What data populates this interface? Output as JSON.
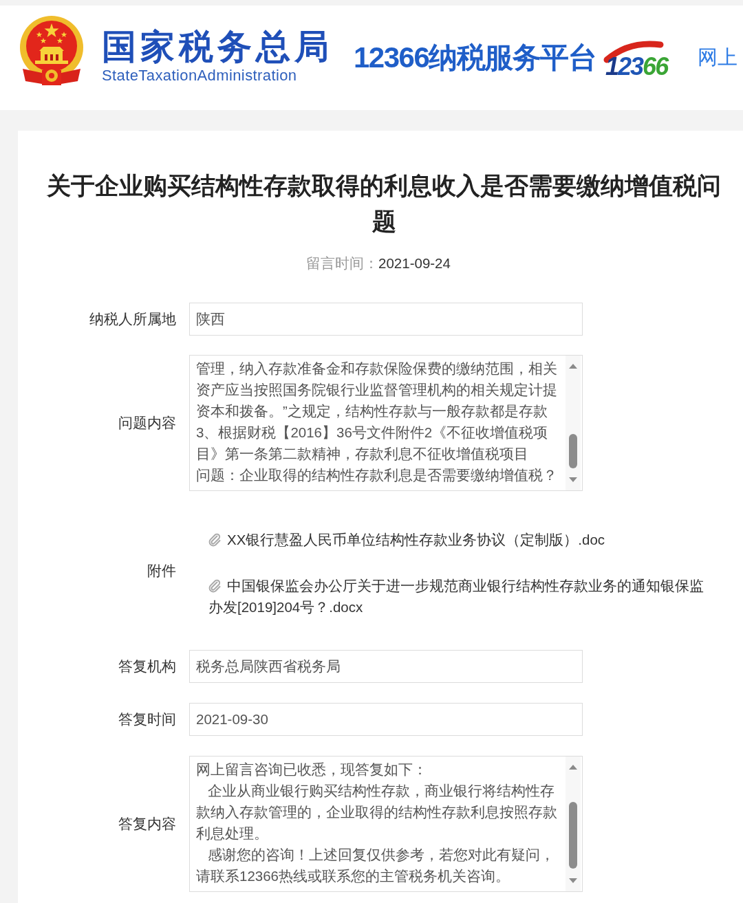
{
  "header": {
    "agency_name": "国家税务总局",
    "agency_name_en": "StateTaxationAdministration",
    "platform_name": "12366纳税服务平台",
    "hotline_logo": "12366",
    "nav_link": "网上"
  },
  "article": {
    "title": "关于企业购买结构性存款取得的利息收入是否需要缴纳增值税问题",
    "posted": {
      "label": "留言时间：",
      "value": "2021-09-24"
    },
    "fields": [
      {
        "kind": "input",
        "label": "纳税人所属地",
        "value": "陕西"
      },
      {
        "kind": "textarea",
        "label": "问题内容",
        "paragraphs": [
          "管理，纳入存款准备金和存款保险保费的缴纳范围，相关资产应当按照国务院银行业监督管理机构的相关规定计提资本和拨备。”之规定，结构性存款与一般存款都是存款",
          "3、根据财税【2016】36号文件附件2《不征收增值税项目》第一条第二款精神，存款利息不征收增值税项目",
          "问题：企业取得的结构性存款利息是否需要缴纳增值税？"
        ]
      },
      {
        "kind": "attachments",
        "label": "附件",
        "files": [
          "XX银行慧盈人民币单位结构性存款业务协议（定制版）.doc",
          "中国银保监会办公厅关于进一步规范商业银行结构性存款业务的通知银保监办发[2019]204号？.docx"
        ]
      },
      {
        "kind": "input",
        "label": "答复机构",
        "value": "税务总局陕西省税务局"
      },
      {
        "kind": "input",
        "label": "答复时间",
        "value": "2021-09-30"
      },
      {
        "kind": "textarea",
        "label": "答复内容",
        "paragraphs": [
          "网上留言咨询已收悉，现答复如下：",
          "   企业从商业银行购买结构性存款，商业银行将结构性存款纳入存款管理的，企业取得的结构性存款利息按照存款利息处理。",
          "   感谢您的咨询！上述回复仅供参考，若您对此有疑问，请联系12366热线或联系您的主管税务机关咨询。"
        ]
      }
    ]
  }
}
